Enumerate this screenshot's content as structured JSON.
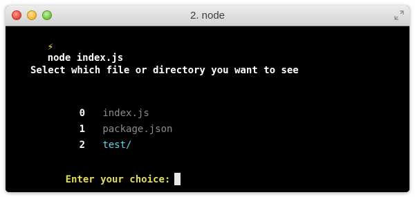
{
  "window": {
    "title": "2. node"
  },
  "terminal": {
    "prompt_symbol": "⚡",
    "command": "node index.js",
    "question": "Select which file or directory you want to see",
    "options": [
      {
        "index": "0",
        "name": "index.js",
        "kind": "file"
      },
      {
        "index": "1",
        "name": "package.json",
        "kind": "file"
      },
      {
        "index": "2",
        "name": "test/",
        "kind": "directory"
      }
    ],
    "choice_label": "Enter your choice:"
  },
  "colors": {
    "background": "#000000",
    "prompt_symbol": "#f7e03c",
    "file": "#8c8c8c",
    "directory": "#5fd7e8",
    "choice_label": "#e3dd5d"
  },
  "icons": {
    "close": "close-icon",
    "minimize": "minimize-icon",
    "zoom": "zoom-icon",
    "fullscreen": "fullscreen-icon"
  }
}
